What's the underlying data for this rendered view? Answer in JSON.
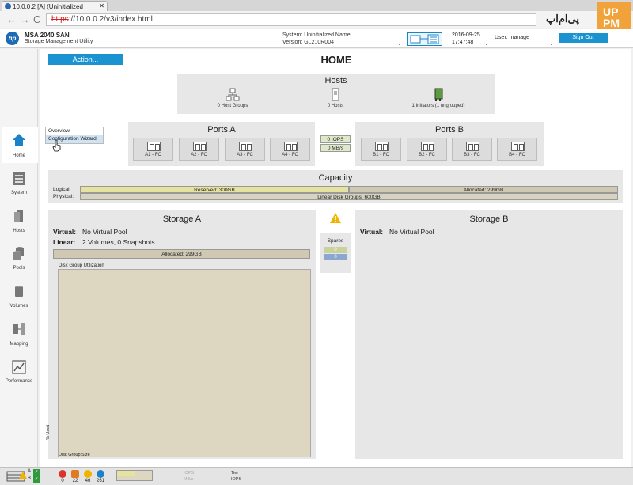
{
  "browser": {
    "tab_title": "10.0.0.2 [A] (Uninitialized",
    "url_proto": "https",
    "url_rest": "://10.0.0.2/v3/index.html"
  },
  "watermark": {
    "text": "پی‌ام‌اپ",
    "logo": "UP PM"
  },
  "header": {
    "app_title": "MSA 2040 SAN",
    "app_subtitle": "Storage Management Utility",
    "system_label": "System: Uninitialized Name",
    "version_label": "Version: GL210R004",
    "date": "2016-09-25",
    "time": "17:47:48",
    "user_label": "User: manage",
    "sign_out": "Sign Out",
    "logo_text": "hp"
  },
  "sidebar": {
    "items": [
      {
        "label": "Home",
        "icon": "home-icon"
      },
      {
        "label": "System",
        "icon": "system-icon"
      },
      {
        "label": "Hosts",
        "icon": "hosts-icon"
      },
      {
        "label": "Pools",
        "icon": "pools-icon"
      },
      {
        "label": "Volumes",
        "icon": "volumes-icon"
      },
      {
        "label": "Mapping",
        "icon": "mapping-icon"
      },
      {
        "label": "Performance",
        "icon": "performance-icon"
      }
    ]
  },
  "action_menu": {
    "button": "Action...",
    "items": [
      "Overview",
      "Configuration Wizard"
    ]
  },
  "page_title": "HOME",
  "hosts": {
    "title": "Hosts",
    "host_groups": "0 Host Groups",
    "hosts": "0 Hosts",
    "initiators": "1 Initiators (1 ungrouped)"
  },
  "ports_a": {
    "title": "Ports A",
    "ports": [
      "A1 - FC",
      "A2 - FC",
      "A3 - FC",
      "A4 - FC"
    ]
  },
  "ports_b": {
    "title": "Ports B",
    "ports": [
      "B1 - FC",
      "B2 - FC",
      "B3 - FC",
      "B4 - FC"
    ]
  },
  "throughput": {
    "iops": "0 IOPS",
    "mbs": "0 MB/s"
  },
  "capacity": {
    "title": "Capacity",
    "logical_label": "Logical:",
    "physical_label": "Physical:",
    "reserved": "Reserved: 300GB",
    "allocated": "Allocated: 299GB",
    "linear_disk_groups": "Linear Disk Groups: 600GB",
    "reserved_fraction": 0.5
  },
  "storage_a": {
    "title": "Storage A",
    "virtual_label": "Virtual:",
    "virtual_value": "No Virtual Pool",
    "linear_label": "Linear:",
    "linear_value": "2 Volumes, 0 Snapshots",
    "allocated": "Allocated: 299GB",
    "dgu_title": "Disk Group Utilization",
    "dgu_ylabel": "% Used",
    "dgu_xlabel": "Disk Group Size"
  },
  "storage_b": {
    "title": "Storage B",
    "virtual_label": "Virtual:",
    "virtual_value": "No Virtual Pool"
  },
  "spares": {
    "title": "Spares",
    "values": [
      "0",
      "0"
    ]
  },
  "statusbar": {
    "alerts": [
      "0",
      "22",
      "46",
      "261"
    ],
    "iops": "IOPS",
    "mbs": "MB/s",
    "tier": "Tier",
    "tier_iops": "IOPS",
    "ctrl_a": "A",
    "ctrl_b": "B"
  },
  "colors": {
    "accent": "#1b93d1",
    "reserved": "#e6e2a0",
    "allocated": "#cfc9b4",
    "physical": "#d8d3bf"
  }
}
